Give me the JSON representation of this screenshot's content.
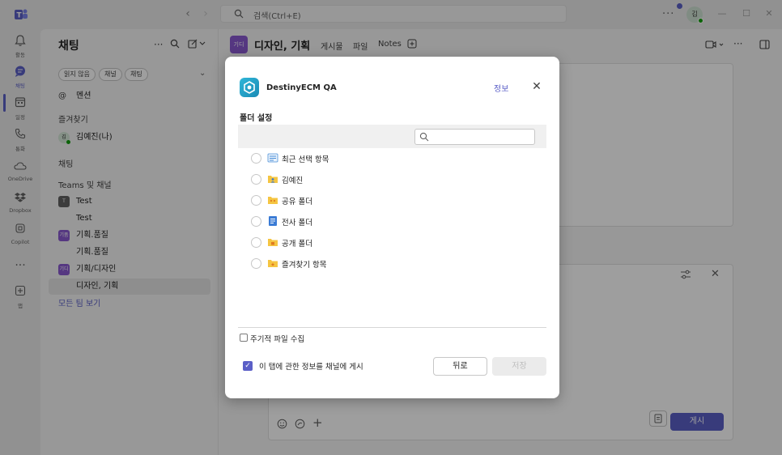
{
  "titlebar": {
    "search_placeholder": "검색(Ctrl+E)",
    "avatar_initials": "김",
    "more": "···"
  },
  "rail": {
    "items": [
      {
        "icon": "bell-icon",
        "label": "활동"
      },
      {
        "icon": "chat-icon",
        "label": "채팅"
      },
      {
        "icon": "calendar-icon",
        "label": "일정"
      },
      {
        "icon": "phone-icon",
        "label": "통화"
      },
      {
        "icon": "cloud-icon",
        "label": "OneDrive"
      },
      {
        "icon": "dropbox-icon",
        "label": "Dropbox"
      },
      {
        "icon": "copilot-icon",
        "label": "Copilot"
      },
      {
        "icon": "more-icon",
        "label": ""
      },
      {
        "icon": "add-app-icon",
        "label": "앱"
      }
    ]
  },
  "chat": {
    "title": "채팅",
    "filters": [
      "읽지 않음",
      "채널",
      "채팅"
    ],
    "mentions": "멘션",
    "favorites_label": "즐겨찾기",
    "favorite_user": "김예진(나)",
    "chat_label": "채팅",
    "teams_label": "Teams 및 채널",
    "teams": [
      {
        "name": "Test",
        "avatar": "T",
        "color": "#616161",
        "channel": "Test"
      },
      {
        "name": "기획.품질",
        "avatar": "기품",
        "color": "#8a5ad1",
        "channel": "기획.품질"
      },
      {
        "name": "기획/디자인",
        "avatar": "기디",
        "color": "#8a5ad1",
        "channel": "디자인, 기획"
      }
    ],
    "see_all": "모든 팀 보기"
  },
  "main": {
    "team_avatar": "기디",
    "title": "디자인, 기획",
    "tabs": [
      "게시물",
      "파일",
      "Notes"
    ],
    "post_button": "게시"
  },
  "dialog": {
    "app_name": "DestinyECM QA",
    "info_link": "정보",
    "section_title": "폴더 설정",
    "folders": [
      {
        "label": "최근 선택 항목",
        "icon": "recent-list-icon"
      },
      {
        "label": "김예진",
        "icon": "user-folder-icon"
      },
      {
        "label": "공유 폴더",
        "icon": "shared-folder-icon"
      },
      {
        "label": "전사 폴더",
        "icon": "company-doc-icon"
      },
      {
        "label": "공개 폴더",
        "icon": "public-folder-icon"
      },
      {
        "label": "즐겨찾기 항목",
        "icon": "favorite-folder-icon"
      }
    ],
    "periodic_collect": "주기적 파일 수집",
    "post_to_channel": "이 탭에 관한 정보를 채널에 게시",
    "back_label": "뒤로",
    "save_label": "저장"
  },
  "colors": {
    "accent": "#5b5fc7",
    "app_logo": "#2fb6d8"
  }
}
